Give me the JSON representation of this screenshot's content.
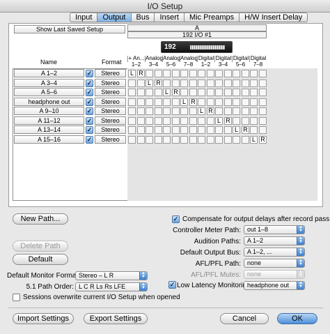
{
  "window": {
    "title": "I/O Setup"
  },
  "tabs": [
    "Input",
    "Output",
    "Bus",
    "Insert",
    "Mic Preamps",
    "H/W Insert Delay"
  ],
  "active_tab": 1,
  "show_last_saved": "Show Last Saved Setup",
  "columns": {
    "name": "Name",
    "format": "Format"
  },
  "group_header": "A",
  "device_header": "192 I/O #1",
  "device_badge": "192",
  "channel_groups": [
    {
      "top": "+ An...",
      "bottom": "1–2"
    },
    {
      "top": "Analog",
      "bottom": "3–4"
    },
    {
      "top": "Analog",
      "bottom": "5–6"
    },
    {
      "top": "Analog",
      "bottom": "7–8"
    },
    {
      "top": "Digital",
      "bottom": "1–2"
    },
    {
      "top": "Digital",
      "bottom": "3–4"
    },
    {
      "top": "Digital",
      "bottom": "5–6"
    },
    {
      "top": "Digital",
      "bottom": "7–8"
    }
  ],
  "paths": [
    {
      "name": "A 1–2",
      "format": "Stereo",
      "assign": [
        [
          "L",
          0
        ],
        [
          "R",
          1
        ]
      ]
    },
    {
      "name": "A 3–4",
      "format": "Stereo",
      "assign": [
        [
          "L",
          2
        ],
        [
          "R",
          3
        ]
      ]
    },
    {
      "name": "A 5–6",
      "format": "Stereo",
      "assign": [
        [
          "L",
          4
        ],
        [
          "R",
          5
        ]
      ]
    },
    {
      "name": "headphone out",
      "format": "Stereo",
      "assign": [
        [
          "L",
          6
        ],
        [
          "R",
          7
        ]
      ]
    },
    {
      "name": "A 9–10",
      "format": "Stereo",
      "assign": [
        [
          "L",
          8
        ],
        [
          "R",
          9
        ]
      ]
    },
    {
      "name": "A 11–12",
      "format": "Stereo",
      "assign": [
        [
          "L",
          10
        ],
        [
          "R",
          11
        ]
      ]
    },
    {
      "name": "A 13–14",
      "format": "Stereo",
      "assign": [
        [
          "L",
          12
        ],
        [
          "R",
          13
        ]
      ]
    },
    {
      "name": "A 15–16",
      "format": "Stereo",
      "assign": [
        [
          "L",
          14
        ],
        [
          "R",
          15
        ]
      ]
    }
  ],
  "buttons": {
    "new_path": "New Path...",
    "delete_path": "Delete Path",
    "default": "Default",
    "import": "Import Settings",
    "export": "Export Settings",
    "cancel": "Cancel",
    "ok": "OK"
  },
  "left_options": {
    "monitor_format_label": "Default Monitor Format:",
    "monitor_format_value": "Stereo – L R",
    "path_order_label": "5.1 Path Order:",
    "path_order_value": "L C R Ls Rs LFE",
    "sessions_overwrite": "Sessions overwrite current I/O Setup when opened"
  },
  "right_options": {
    "compensate": "Compensate for output delays after record pass",
    "meter_path_label": "Controller Meter Path:",
    "meter_path_value": "out 1–8",
    "audition_label": "Audition Paths:",
    "audition_value": "A 1–2",
    "default_bus_label": "Default Output Bus:",
    "default_bus_value": "A 1–2, ...",
    "afl_path_label": "AFL/PFL Path:",
    "afl_path_value": "none",
    "afl_mutes_label": "AFL/PFL Mutes:",
    "afl_mutes_value": "none",
    "low_latency_label": "Low Latency Monitoring:",
    "low_latency_value": "headphone out"
  }
}
